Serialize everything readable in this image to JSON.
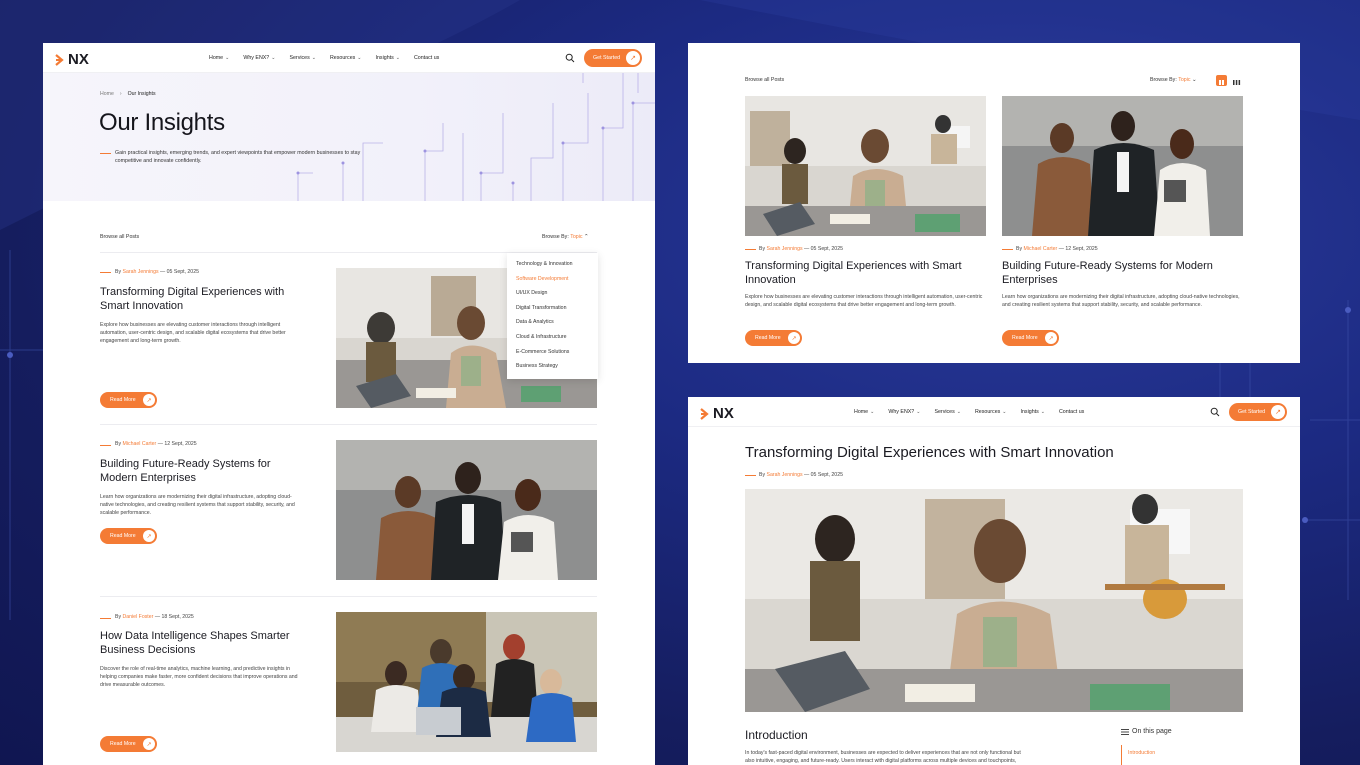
{
  "brand": {
    "logo": "NX",
    "accent": "#f47b35"
  },
  "nav": {
    "items": [
      "Home",
      "Why ENX?",
      "Services",
      "Resources",
      "Insights",
      "Contact us"
    ],
    "cta": "Get Started"
  },
  "insights_page": {
    "breadcrumb": {
      "home": "Home",
      "current": "Our Insights"
    },
    "title": "Our Insights",
    "description": "Gain practical insights, emerging trends, and expert viewpoints that empower modern businesses to stay competitive and innovate confidently.",
    "browse_all": "Browse all Posts",
    "browse_by": "Browse By:",
    "browse_value": "Topic",
    "dropdown": [
      "Technology & Innovation",
      "Software Development",
      "UI/UX Design",
      "Digital Transformation",
      "Data & Analytics",
      "Cloud & Infrastructure",
      "E-Commerce Solutions",
      "Business Strategy"
    ],
    "dropdown_active": "Software Development",
    "posts": [
      {
        "by": "By",
        "author": "Sarah Jennings",
        "date": "— 05 Sept, 2025",
        "title": "Transforming Digital Experiences with Smart Innovation",
        "desc": "Explore how businesses are elevating customer interactions through intelligent automation, user-centric design, and scalable digital ecosystems that drive better engagement and long-term growth.",
        "cta": "Read More"
      },
      {
        "by": "By",
        "author": "Michael Carter",
        "date": "— 12 Sept, 2025",
        "title": "Building Future-Ready Systems for Modern Enterprises",
        "desc": "Learn how organizations are modernizing their digital infrastructure, adopting cloud-native technologies, and creating resilient systems that support stability, security, and scalable performance.",
        "cta": "Read More"
      },
      {
        "by": "By",
        "author": "Daniel Foster",
        "date": "— 18 Sept, 2025",
        "title": "How Data Intelligence Shapes Smarter Business Decisions",
        "desc": "Discover the role of real-time analytics, machine learning, and predictive insights in helping companies make faster, more confident decisions that improve operations and drive measurable outcomes.",
        "cta": "Read More"
      }
    ]
  },
  "grid_page": {
    "browse_all": "Browse all Posts",
    "browse_by": "Browse By:",
    "browse_value": "Topic"
  },
  "article_page": {
    "title": "Transforming Digital Experiences with Smart Innovation",
    "by": "By",
    "author": "Sarah Jennings",
    "date": "— 05 Sept, 2025",
    "section": "Introduction",
    "body": "In today's fast-paced digital environment, businesses are expected to deliver experiences that are not only functional but also intuitive, engaging, and future-ready. Users interact with digital platforms across multiple devices and touchpoints, making experience quality a",
    "toc_title": "On this page",
    "toc_items": [
      "Introduction"
    ]
  }
}
